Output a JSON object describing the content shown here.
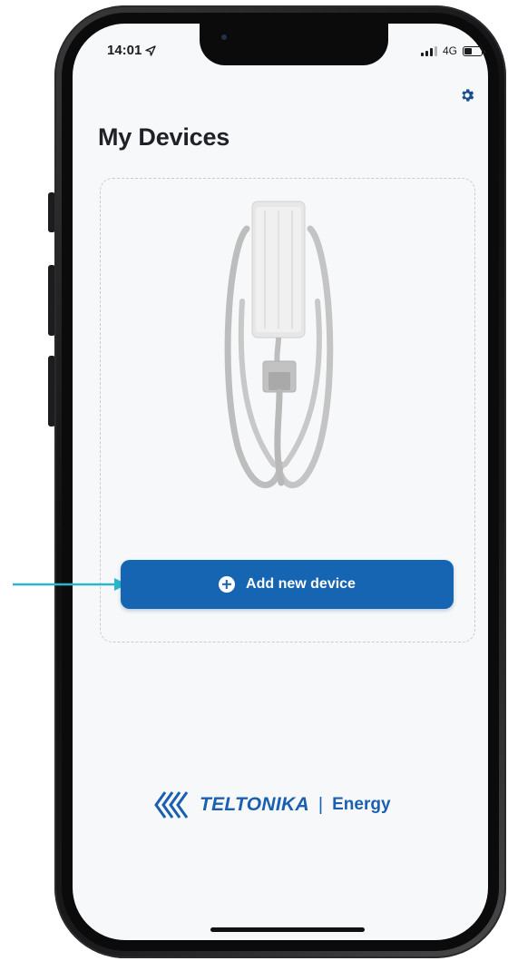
{
  "status_bar": {
    "time": "14:01",
    "network": "4G"
  },
  "header": {
    "title": "My Devices",
    "settings_icon": "gear-icon"
  },
  "empty_state": {
    "illustration": "ev-charger-illustration",
    "add_button_label": "Add new device",
    "add_button_icon": "plus-circle-icon"
  },
  "footer": {
    "brand_name": "TELTONIKA",
    "separator": "|",
    "product": "Energy"
  },
  "colors": {
    "accent": "#1565b2",
    "brand": "#1a5fb0",
    "annotation": "#2bb6cc",
    "background": "#f6f8fa"
  }
}
